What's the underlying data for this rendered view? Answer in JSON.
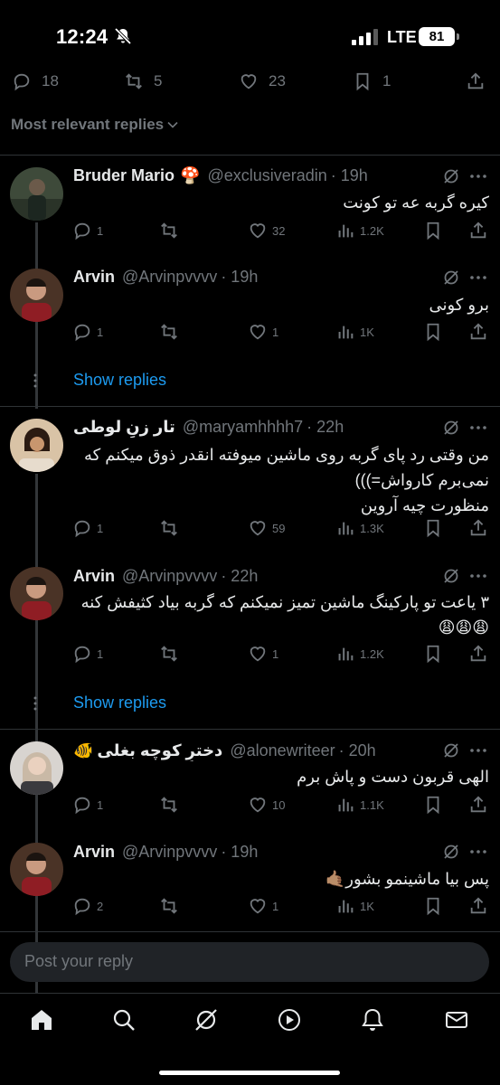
{
  "status": {
    "time": "12:24",
    "network": "LTE",
    "battery": "81"
  },
  "post_stats": {
    "replies": "18",
    "reposts": "5",
    "likes": "23",
    "bookmarks": "1"
  },
  "sort_label": "Most relevant replies",
  "show_replies_label": "Show replies",
  "replies": [
    {
      "name": "Bruder Mario",
      "badge": "🍄",
      "handle": "@exclusiveradin",
      "time": "· 19h",
      "text": "کیره گربه عه تو کونت",
      "stats": {
        "replies": "1",
        "reposts": "",
        "likes": "32",
        "views": "1.2K"
      }
    },
    {
      "name": "Arvin",
      "handle": "@Arvinpvvvv",
      "time": "· 19h",
      "text": "برو کونی",
      "stats": {
        "replies": "1",
        "reposts": "",
        "likes": "1",
        "views": "1K"
      }
    },
    {
      "name": "تار زنِ لوطی",
      "handle": "@maryamhhhh7",
      "time": "· 22h",
      "text": "من وقتی رد پای گربه روی ماشین میوفته انقدر ذوق میکنم که نمی‌برم کارواش=)))\nمنظورت چیه آروین",
      "stats": {
        "replies": "1",
        "reposts": "",
        "likes": "59",
        "views": "1.3K"
      }
    },
    {
      "name": "Arvin",
      "handle": "@Arvinpvvvv",
      "time": "· 22h",
      "text": "۳ یاعت تو پارکینگ ماشین تمیز نمیکنم که گربه بیاد کثیفش کنه 😩😩😩",
      "stats": {
        "replies": "1",
        "reposts": "",
        "likes": "1",
        "views": "1.2K"
      }
    },
    {
      "name": "دخترِ کوچه بغلی",
      "badge": "🐠",
      "handle": "@alonewriteer",
      "time": "· 20h",
      "text": "الهی قربون دست و پاش برم",
      "stats": {
        "replies": "1",
        "reposts": "",
        "likes": "10",
        "views": "1.1K"
      }
    },
    {
      "name": "Arvin",
      "handle": "@Arvinpvvvv",
      "time": "· 19h",
      "text": "پس بیا ماشینمو بشور🤙🏽",
      "stats": {
        "replies": "2",
        "reposts": "",
        "likes": "1",
        "views": "1K"
      }
    }
  ],
  "reply_box": {
    "placeholder": "Post your reply"
  },
  "colors": {
    "accent": "#1d9bf0",
    "muted": "#71767b",
    "text": "#e7e9ea",
    "background": "#000000",
    "divider": "#2f3336"
  }
}
